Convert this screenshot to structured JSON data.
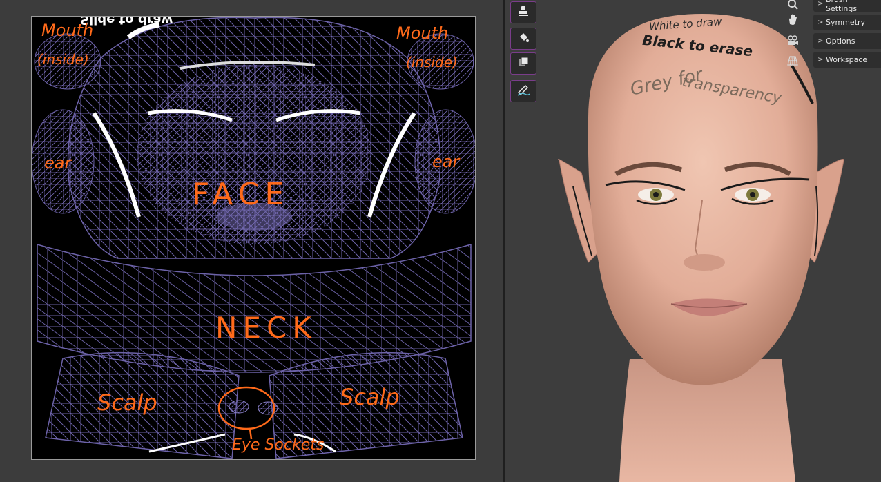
{
  "uv_editor": {
    "image_header": "Slide to draw",
    "labels": {
      "mouth_left": "Mouth",
      "mouth_left_sub": "(inside)",
      "mouth_right": "Mouth",
      "mouth_right_sub": "(inside)",
      "ear_left": "ear",
      "ear_right": "ear",
      "face": "FACE",
      "neck": "NECK",
      "scalp_left": "Scalp",
      "scalp_right": "Scalp",
      "eye_sockets": "Eye Sockets"
    }
  },
  "viewport": {
    "head_text": {
      "line1": "White to draw",
      "line2": "Black to erase",
      "line3": "Grey for",
      "line4": "transparency"
    },
    "tools": [
      {
        "icon": "clone-stamp-icon"
      },
      {
        "icon": "fill-bucket-icon"
      },
      {
        "icon": "mask-icon"
      },
      {
        "icon": "annotate-pen-icon"
      }
    ],
    "nav_icons": [
      "zoom-icon",
      "hand-pan-icon",
      "camera-icon",
      "grid-perspective-icon"
    ],
    "panels": [
      "Brush Settings",
      "Symmetry",
      "Options",
      "Workspace"
    ]
  },
  "colors": {
    "mesh": "#6c62a8",
    "annotation_orange": "#ff6a1a",
    "tool_border": "#7a3d8a"
  }
}
